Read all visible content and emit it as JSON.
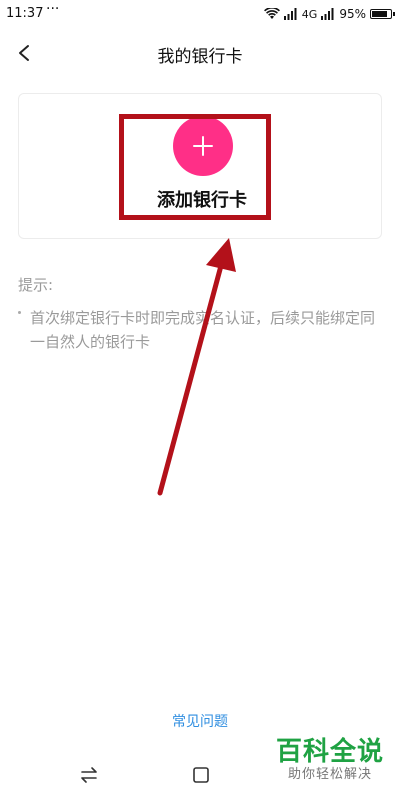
{
  "status_bar": {
    "time": "11:37",
    "dots": "···",
    "network": "4G",
    "battery_text": "95%",
    "battery_level": 0.95
  },
  "header": {
    "title": "我的银行卡"
  },
  "card": {
    "add_label": "添加银行卡",
    "plus_color": "#ff2f87"
  },
  "tips": {
    "title": "提示:",
    "text": "首次绑定银行卡时即完成实名认证，后续只能绑定同一自然人的银行卡"
  },
  "footer": {
    "faq_label": "常见问题"
  },
  "watermark": {
    "main": "百科全说",
    "sub": "助你轻松解决"
  },
  "colors": {
    "accent_link": "#2f8ee0",
    "annotation_red": "#b3111a",
    "watermark_green": "#1fa243"
  }
}
